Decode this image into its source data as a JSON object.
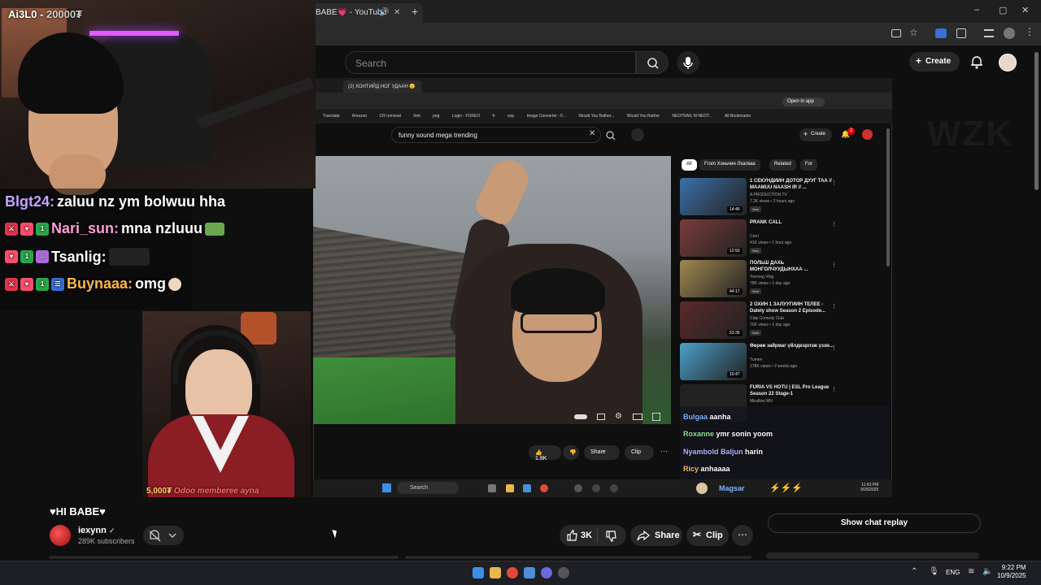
{
  "browser": {
    "tab_title": "BABE💗 - YouTube",
    "new_tab": "+",
    "window_controls": [
      "–",
      "▢",
      "✕"
    ]
  },
  "youtube": {
    "search_placeholder": "Search",
    "create_label": "Create"
  },
  "inner_browser": {
    "tab_title": "(2) ХОНТИЙД НОГ УДААН 😊",
    "open_in_app": "Open in app",
    "bookmarks": [
      "Translate",
      "Amazon",
      "CR removal",
      "font",
      "png",
      "Login - FOREO",
      "fr",
      "exp",
      "Image Converter - F...",
      "Would You Rather...",
      "Would You Rather",
      "NEOTRAIL M-NEOT...",
      "All Bookmarks"
    ],
    "search_value": "funny sound mega trending",
    "create_label": "Create",
    "notif_count": "2",
    "actions": {
      "like": "1.8K",
      "share": "Share",
      "clip": "Clip",
      "more": "⋯"
    },
    "chips": [
      "All",
      "From Хоньчин Лхагваа",
      "Related",
      "For"
    ],
    "recommendations": [
      {
        "title": "1 СЕКУНДИЙН ДОТОР ДУУГ ТАА // MAAMUU NAASH IR // ...",
        "channel": "A PRODUCTION TV",
        "meta": "7.2K views • 2 hours ago",
        "badge": "New",
        "duration": "14:46",
        "color": "#3c6fa8"
      },
      {
        "title": "PRANK CALL",
        "channel": "Cerri",
        "meta": "41K views • 1 hour ago",
        "badge": "New",
        "duration": "12:50",
        "color": "#7a3b3b"
      },
      {
        "title": "ПОЛЬШ ДАХЬ МОНГОЛЧУУДЫНХАА ...",
        "channel": "Tserneg Vlog",
        "meta": "78K views • 1 day ago",
        "badge": "New",
        "duration": "44:17",
        "color": "#a08850"
      },
      {
        "title": "2 ОХИН 1 ЗАЛУУГИЙН ТЕЛЕЕ - Dately show Season 2 Episode...",
        "channel": "Clap Comedy Club",
        "meta": "70K views • 1 day ago",
        "badge": "New",
        "duration": "53:39",
        "color": "#5a2a2a"
      },
      {
        "title": "Өөрөө зайрмаг үйлдвэрлэж үзэв...",
        "channel": "Tumen",
        "meta": "178K views • 2 weeks ago",
        "badge": "",
        "duration": "10:47",
        "color": "#4aa0c8"
      },
      {
        "title": "FURIA VS HOTU | ESL Pro League Season 22 Stage-1",
        "channel": "MiraRes MN",
        "meta": "",
        "badge": "",
        "duration": "",
        "color": "#222"
      }
    ],
    "overlay_chat": [
      {
        "user": "Bulgaa",
        "msg": "aanha"
      },
      {
        "user": "Roxanne",
        "msg": "ymr sonin yoom"
      },
      {
        "user": "Nyambold Baljun",
        "msg": "harin"
      },
      {
        "user": "Ricy",
        "msg": "anhaaaa"
      },
      {
        "user": "Magsar",
        "msg": ""
      }
    ],
    "taskbar_search": "Search",
    "clock_time": "11:43 PM",
    "clock_date": "9/26/2025"
  },
  "stream": {
    "overlay_label": "Ai3L0 - ",
    "overlay_score": "20000₮",
    "cam2_label_amount": "5,000₮",
    "cam2_label_text": "Odoo memberee ayna",
    "chat": [
      {
        "user": "Blgt24:",
        "msg": "zaluu nz ym bolwuu hha",
        "color": "#c7a4ff",
        "badges": 0
      },
      {
        "user": "Nari_sun:",
        "msg": "mna nzluuu",
        "color": "#ff9ed6",
        "badges": 3
      },
      {
        "user": "Tsanlig:",
        "msg": "",
        "color": "#fff",
        "badges": 3
      },
      {
        "user": "Buynaaa:",
        "msg": "omg",
        "color": "#ffb84d",
        "badges": 4
      }
    ]
  },
  "video_info": {
    "title": "♥HI BABE♥",
    "channel": "iexynn",
    "verified": "✓",
    "subscribers": "289K subscribers",
    "likes": "3K",
    "share": "Share",
    "clip": "Clip",
    "more": "⋯",
    "show_chat_replay": "Show chat replay"
  },
  "taskbar": {
    "lang": "ENG",
    "time": "9:22 PM",
    "date": "10/9/2025"
  },
  "colors": {
    "background": "#0f0f0f",
    "chip_bg": "#272727",
    "accent_red": "#ff0000"
  }
}
